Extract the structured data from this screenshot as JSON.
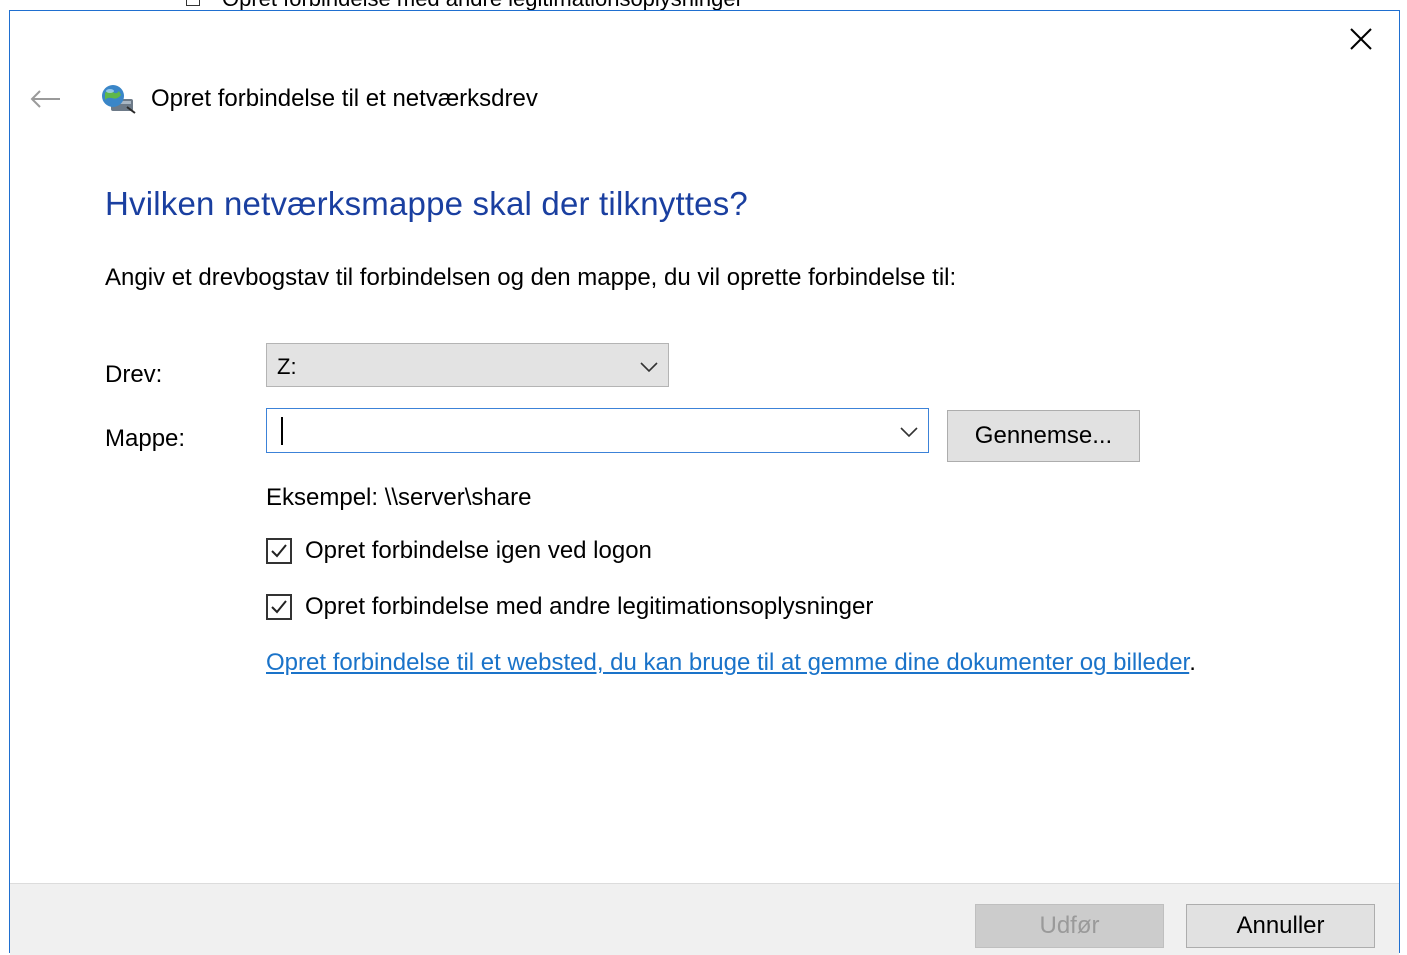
{
  "background": {
    "partial_checkbox_text": "Opret forbindelse med andre legitimationsoplysninger"
  },
  "dialog": {
    "title": "Opret forbindelse til et netværksdrev",
    "heading": "Hvilken netværksmappe skal der tilknyttes?",
    "instruction": "Angiv et drevbogstav til forbindelsen og den mappe, du vil oprette forbindelse til:",
    "drive": {
      "label": "Drev:",
      "value": "Z:"
    },
    "folder": {
      "label": "Mappe:",
      "value": "",
      "browse_label": "Gennemse..."
    },
    "example": "Eksempel: \\\\server\\share",
    "reconnect_checkbox": {
      "label": "Opret forbindelse igen ved logon",
      "checked": true
    },
    "credentials_checkbox": {
      "label": "Opret forbindelse med andre legitimationsoplysninger",
      "checked": true
    },
    "link_text": "Opret forbindelse til et websted, du kan bruge til at gemme dine dokumenter og billeder",
    "link_suffix": ".",
    "footer": {
      "finish_label": "Udfør",
      "finish_enabled": false,
      "cancel_label": "Annuller"
    }
  },
  "icons": {
    "close": "close-icon",
    "back": "back-arrow-icon",
    "app": "network-drive-icon",
    "dropdown": "chevron-down-icon",
    "check": "checkmark-icon"
  },
  "colors": {
    "heading": "#1a3fa0",
    "link": "#1a73c9",
    "border_accent": "#1f6fd0",
    "footer_bg": "#f0f0f0"
  }
}
